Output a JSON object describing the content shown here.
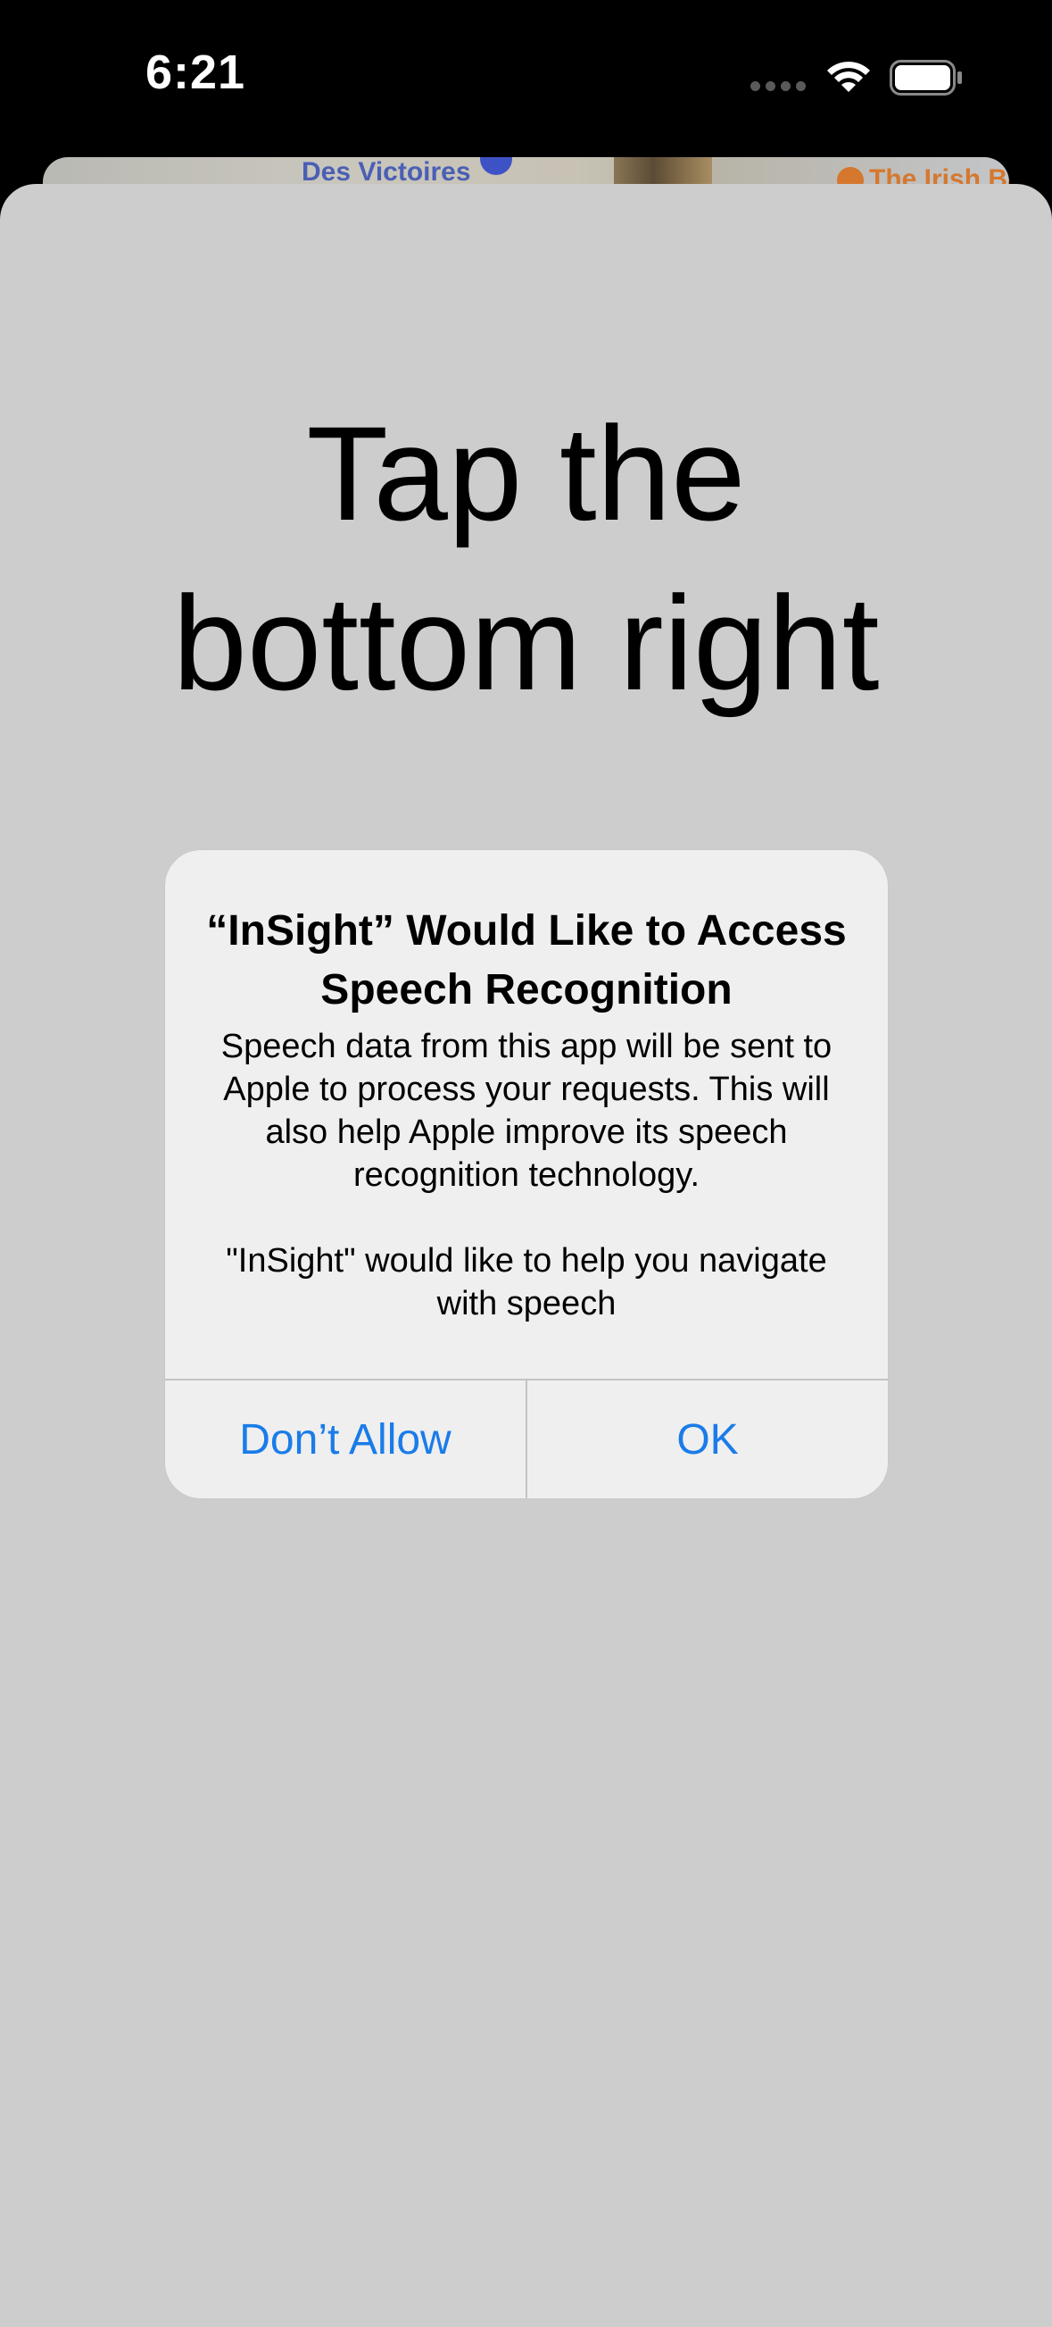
{
  "status_bar": {
    "time": "6:21"
  },
  "map": {
    "label_left": "Des Victoires",
    "label_right": "The Irish Ban"
  },
  "instruction": {
    "line1": "Tap the",
    "line2": "bottom right"
  },
  "alert": {
    "title": "“InSight” Would Like to Access Speech Recognition",
    "message_primary": "Speech data from this app will be sent to Apple to process your requests. This will also help Apple improve its speech recognition technology.",
    "message_secondary": "\"InSight\" would like to help you navigate with speech",
    "dont_allow_label": "Don’t Allow",
    "ok_label": "OK"
  },
  "colors": {
    "accent": "#1a7ce8",
    "sheet_background": "#cdcdcd",
    "alert_background": "#f0f0f0"
  },
  "icons": [
    "wifi-icon",
    "battery-icon",
    "signal-dots-icon",
    "metro-icon",
    "map-pin-icon"
  ]
}
